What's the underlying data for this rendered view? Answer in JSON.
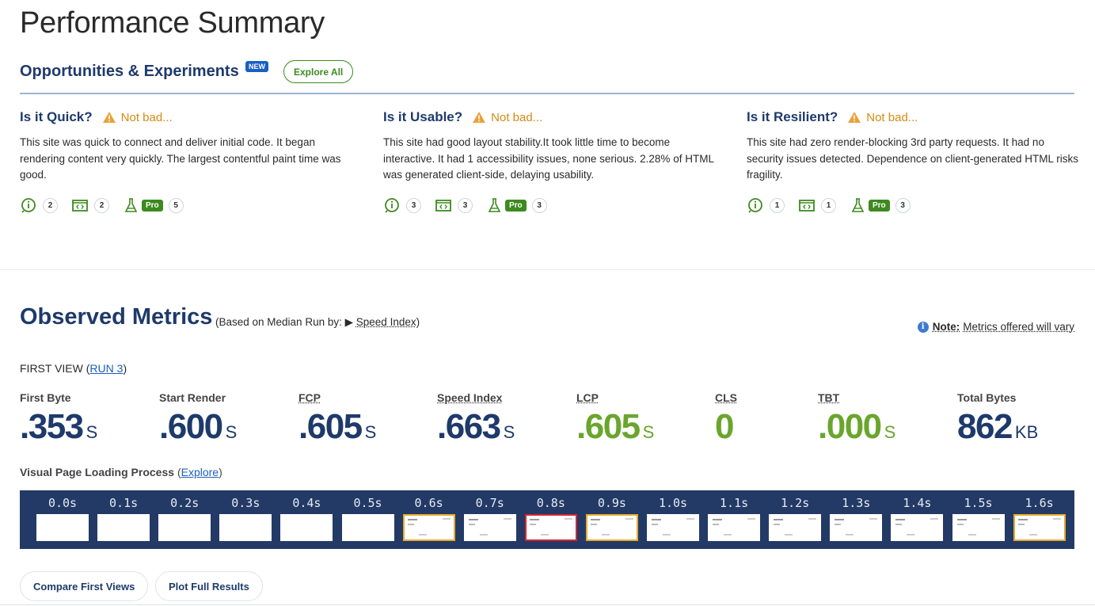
{
  "page_title": "Performance Summary",
  "opportunities": {
    "title": "Opportunities & Experiments",
    "badge": "NEW",
    "explore_label": "Explore All"
  },
  "columns": [
    {
      "heading": "Is it Quick?",
      "verdict": "Not bad...",
      "description": "This site was quick to connect and deliver initial code. It began rendering content very quickly. The largest contentful paint time was good.",
      "counts": {
        "insights": "2",
        "experiments": "2",
        "pro": "5"
      }
    },
    {
      "heading": "Is it Usable?",
      "verdict": "Not bad...",
      "description": "This site had good layout stability.It took little time to become interactive. It had 1 accessibility issues, none serious. 2.28% of HTML was generated client-side, delaying usability.",
      "counts": {
        "insights": "3",
        "experiments": "3",
        "pro": "3"
      }
    },
    {
      "heading": "Is it Resilient?",
      "verdict": "Not bad...",
      "description": "This site had zero render-blocking 3rd party requests. It had no security issues detected. Dependence on client-generated HTML risks fragility.",
      "counts": {
        "insights": "1",
        "experiments": "1",
        "pro": "3"
      }
    }
  ],
  "pro_label": "Pro",
  "observed": {
    "title": "Observed Metrics",
    "subtitle_prefix": "(Based on Median Run by:",
    "subtitle_arrow": "▶",
    "subtitle_link": "Speed Index",
    "subtitle_suffix": ")",
    "note_info": "i",
    "note_bold": "Note:",
    "note_text": "Metrics offered will vary"
  },
  "first_view": {
    "prefix": "FIRST VIEW (",
    "run": "RUN 3",
    "suffix": ")"
  },
  "metrics": [
    {
      "label": "First Byte",
      "value": ".353",
      "unit": "S"
    },
    {
      "label": "Start Render",
      "value": ".600",
      "unit": "S"
    },
    {
      "label": "FCP",
      "value": ".605",
      "unit": "S"
    },
    {
      "label": "Speed Index",
      "value": ".663",
      "unit": "S"
    },
    {
      "label": "LCP",
      "value": ".605",
      "unit": "S"
    },
    {
      "label": "CLS",
      "value": "0",
      "unit": ""
    },
    {
      "label": "TBT",
      "value": ".000",
      "unit": "S"
    },
    {
      "label": "Total Bytes",
      "value": "862",
      "unit": "KB"
    }
  ],
  "visual_loading": {
    "label": "Visual Page Loading Process",
    "open": "(",
    "explore": "Explore",
    "close": ")"
  },
  "frames": [
    {
      "time": "0.0s",
      "state": "blank"
    },
    {
      "time": "0.1s",
      "state": "blank"
    },
    {
      "time": "0.2s",
      "state": "blank"
    },
    {
      "time": "0.3s",
      "state": "blank"
    },
    {
      "time": "0.4s",
      "state": "blank"
    },
    {
      "time": "0.5s",
      "state": "blank"
    },
    {
      "time": "0.6s",
      "state": "changed"
    },
    {
      "time": "0.7s",
      "state": "content"
    },
    {
      "time": "0.8s",
      "state": "lcp"
    },
    {
      "time": "0.9s",
      "state": "changed"
    },
    {
      "time": "1.0s",
      "state": "content"
    },
    {
      "time": "1.1s",
      "state": "content"
    },
    {
      "time": "1.2s",
      "state": "content"
    },
    {
      "time": "1.3s",
      "state": "content"
    },
    {
      "time": "1.4s",
      "state": "content"
    },
    {
      "time": "1.5s",
      "state": "content"
    },
    {
      "time": "1.6s",
      "state": "changed"
    }
  ],
  "buttons": {
    "compare": "Compare First Views",
    "plot": "Plot Full Results"
  },
  "colors": {
    "navy": "#1e3a6b",
    "green": "#6aa52c",
    "warning": "#d48a12",
    "strip": "#233a66",
    "changed": "#e6ac2c",
    "lcp": "#d7262e"
  }
}
